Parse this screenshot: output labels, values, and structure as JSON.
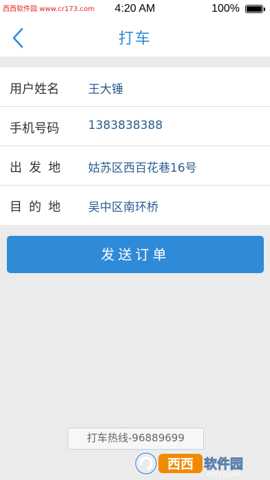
{
  "status_bar": {
    "watermark": "西西软件园 www.cr173.com",
    "time": "4:20 AM",
    "battery_percent": "100%",
    "battery_level": 1.0
  },
  "header": {
    "title": "打车",
    "back_icon": "chevron-left-icon"
  },
  "form": {
    "rows": [
      {
        "label": "用户姓名",
        "value": "王大锤"
      },
      {
        "label": "手机号码",
        "value": "1383838388"
      },
      {
        "label": "出发地",
        "value": "姑苏区西百花巷16号"
      },
      {
        "label": "目的地",
        "value": "吴中区南环桥"
      }
    ]
  },
  "send_button": {
    "label": "发送订单"
  },
  "hotline": {
    "text": "打车热线-96889699"
  },
  "logo": {
    "text": "西西软件园",
    "url_text": "CR173.COM"
  },
  "colors": {
    "accent": "#2f8ad8",
    "value_text": "#2a5d8f",
    "background": "#ebebeb"
  }
}
